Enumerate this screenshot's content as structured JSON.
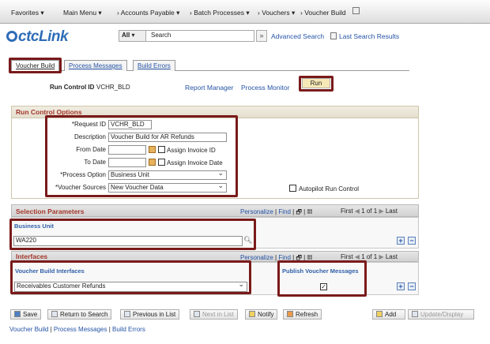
{
  "nav": {
    "favorites": "Favorites ▾",
    "main_menu": "Main Menu ▾",
    "accounts_payable": "›  Accounts Payable ▾",
    "batch_processes": "›  Batch Processes ▾",
    "vouchers": "›  Vouchers ▾",
    "voucher_build": "›  Voucher Build"
  },
  "logo": "ctcLink",
  "search": {
    "scope": "All",
    "placeholder": "Search",
    "advanced": "Advanced Search",
    "last": "Last Search Results"
  },
  "tabs": [
    "Voucher Build",
    "Process Messages",
    "Build Errors"
  ],
  "run": {
    "label": "Run Control ID",
    "value": "VCHR_BLD",
    "report_manager": "Report Manager",
    "process_monitor": "Process Monitor",
    "run_button": "Run"
  },
  "rco": {
    "title": "Run Control Options",
    "request_id_label": "*Request ID",
    "request_id": "VCHR_BLD",
    "description_label": "Description",
    "description": "Voucher Build for AR Refunds",
    "from_date_label": "From Date",
    "to_date_label": "To Date",
    "assign_invoice_id": "Assign Invoice ID",
    "assign_invoice_date": "Assign Invoice Date",
    "process_option_label": "*Process Option",
    "process_option": "Business Unit",
    "voucher_sources_label": "*Voucher Sources",
    "voucher_sources": "New Voucher Data",
    "autopilot": "Autopilot Run Control"
  },
  "sp": {
    "title": "Selection Parameters",
    "personalize": "Personalize",
    "find": "Find",
    "first": "First",
    "count": "1 of 1",
    "last": "Last",
    "bu_header": "Business Unit",
    "bu_value": "WA220"
  },
  "intf": {
    "title": "Interfaces",
    "personalize": "Personalize",
    "find": "Find",
    "first": "First",
    "count": "1 of 1",
    "last": "Last",
    "vbi_header": "Voucher Build Interfaces",
    "vbi_value": "Receivables Customer Refunds",
    "pvm_header": "Publish Voucher Messages"
  },
  "buttons": {
    "save": "Save",
    "return_search": "Return to Search",
    "previous": "Previous in List",
    "next": "Next in List",
    "notify": "Notify",
    "refresh": "Refresh",
    "add": "Add",
    "update": "Update/Display"
  },
  "footer": {
    "voucher_build": "Voucher Build",
    "process_messages": "Process Messages",
    "build_errors": "Build Errors"
  }
}
